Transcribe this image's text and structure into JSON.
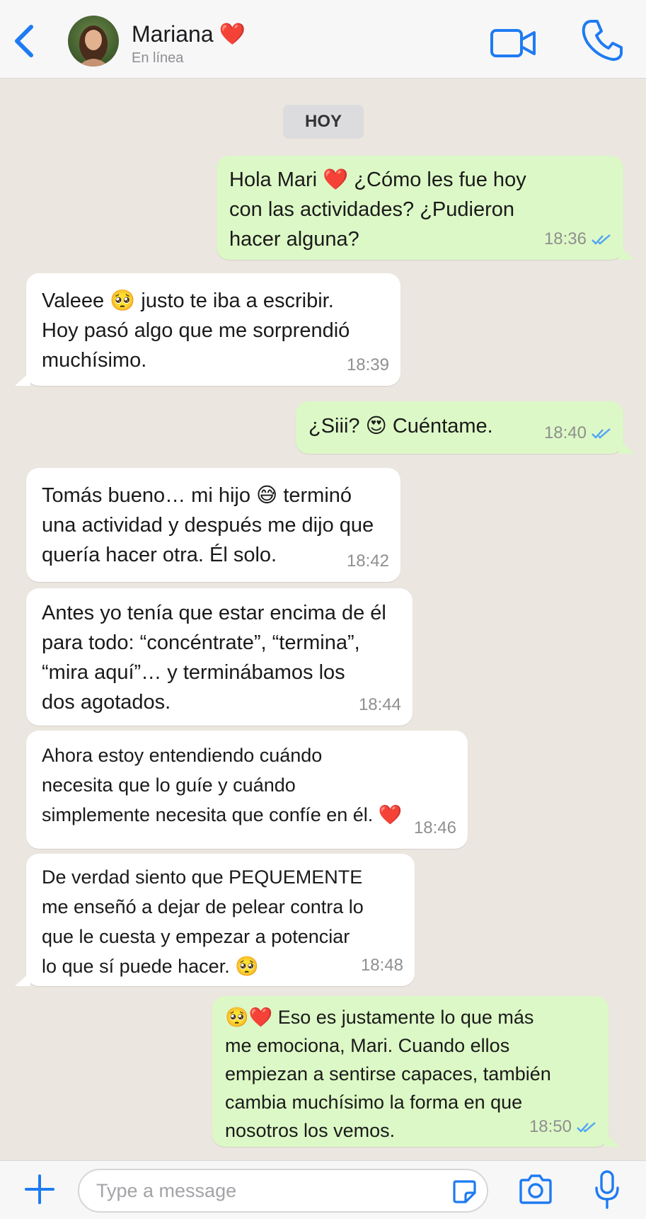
{
  "header": {
    "contact_name": "Mariana",
    "name_emoji": "❤️",
    "status": "En línea"
  },
  "chat": {
    "date_label": "HOY",
    "messages": [
      {
        "dir": "out",
        "text": "Hola Mari ❤️ ¿Cómo les fue hoy\ncon las actividades? ¿Pudieron\nhacer alguna?",
        "time": "18:36",
        "read": true
      },
      {
        "dir": "in",
        "text": "Valeee 🥺 justo te iba a escribir.\nHoy pasó algo que me sorprendió\nmuchísimo.",
        "time": "18:39"
      },
      {
        "dir": "out",
        "text": "¿Siii? 😍 Cuéntame.",
        "time": "18:40",
        "read": true
      },
      {
        "dir": "in",
        "text": "Tomás bueno… mi hijo 😅 terminó\nuna actividad y después me dijo que\nquería hacer otra. Él solo.",
        "time": "18:42"
      },
      {
        "dir": "in",
        "text": "Antes yo tenía que estar encima de él\npara todo: “concéntrate”, “termina”,\n“mira aquí”… y terminábamos los\ndos agotados.",
        "time": "18:44"
      },
      {
        "dir": "in",
        "text": "Ahora estoy entendiendo cuándo\nnecesita que lo guíe y cuándo\nsimplemente necesita que confíe en él. ❤️",
        "time": "18:46"
      },
      {
        "dir": "in",
        "text": "De verdad siento que PEQUEMENTE\nme enseñó a dejar de pelear contra lo\nque le cuesta y empezar a potenciar\nlo que sí puede hacer. 🥺",
        "time": "18:48"
      },
      {
        "dir": "out",
        "text": "🥺❤️  Eso es justamente lo que más\nme emociona, Mari. Cuando ellos\nempiezan a sentirse capaces, también\ncambia muchísimo la forma en que\nnosotros los vemos.",
        "time": "18:50",
        "read": true
      }
    ]
  },
  "input": {
    "placeholder": "Type a message",
    "value": ""
  },
  "colors": {
    "accent": "#1e7bf2",
    "outgoing_bubble": "#dcf8c6",
    "incoming_bubble": "#ffffff",
    "chat_bg": "#ebe6df",
    "read_ticks": "#4fa3f7"
  },
  "icons": [
    "back-chevron-icon",
    "avatar",
    "video-call-icon",
    "phone-icon",
    "read-ticks-icon",
    "plus-icon",
    "sticker-icon",
    "camera-icon",
    "microphone-icon"
  ]
}
